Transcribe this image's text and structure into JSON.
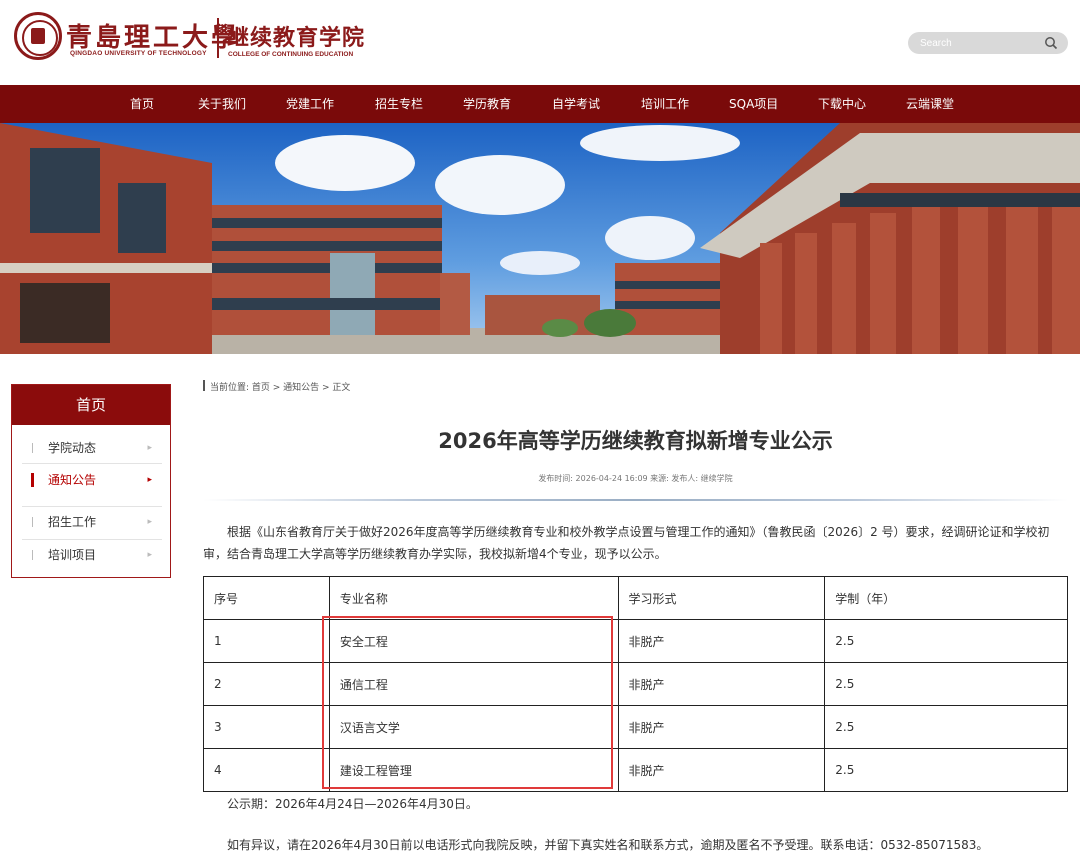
{
  "header": {
    "university_cn": "青島理工大學",
    "university_en": "QINGDAO UNIVERSITY OF TECHNOLOGY",
    "college_cn": "继续教育学院",
    "college_en": "COLLEGE OF CONTINUING EDUCATION",
    "search_placeholder": "Search",
    "search_icon": "search-icon"
  },
  "nav": {
    "items": [
      "首页",
      "关于我们",
      "党建工作",
      "招生专栏",
      "学历教育",
      "自学考试",
      "培训工作",
      "SQA项目",
      "下载中心",
      "云端课堂"
    ]
  },
  "sidebar": {
    "title": "首页",
    "items": [
      {
        "label": "学院动态",
        "active": false
      },
      {
        "label": "通知公告",
        "active": true
      },
      {
        "label": "招生工作",
        "active": false
      },
      {
        "label": "培训项目",
        "active": false
      }
    ],
    "arrow": "▸"
  },
  "breadcrumb": "当前位置: 首页 > 通知公告 > 正文",
  "article": {
    "title": "2026年高等学历继续教育拟新增专业公示",
    "meta": "发布时间: 2026-04-24 16:09   来源:      发布人: 继续学院",
    "paragraph": "根据《山东省教育厅关于做好2026年度高等学历继续教育专业和校外教学点设置与管理工作的通知》（鲁教民函〔2026〕2 号）要求，经调研论证和学校初审，结合青岛理工大学高等学历继续教育办学实际，我校拟新增4个专业，现予以公示。",
    "table": {
      "headers": [
        "序号",
        "专业名称",
        "学习形式",
        "学制（年）"
      ],
      "rows": [
        [
          "1",
          "安全工程",
          "非脱产",
          "2.5"
        ],
        [
          "2",
          "通信工程",
          "非脱产",
          "2.5"
        ],
        [
          "3",
          "汉语言文学",
          "非脱产",
          "2.5"
        ],
        [
          "4",
          "建设工程管理",
          "非脱产",
          "2.5"
        ]
      ]
    },
    "period": "公示期：2026年4月24日—2026年4月30日。",
    "objection": "如有异议，请在2026年4月30日前以电话形式向我院反映，并留下真实姓名和联系方式，逾期及匿名不予受理。联系电话：0532-85071583。"
  },
  "colors": {
    "brand": "#8b1a1a",
    "nav_bg": "#7a0a0a",
    "highlight": "#e03a3a"
  }
}
